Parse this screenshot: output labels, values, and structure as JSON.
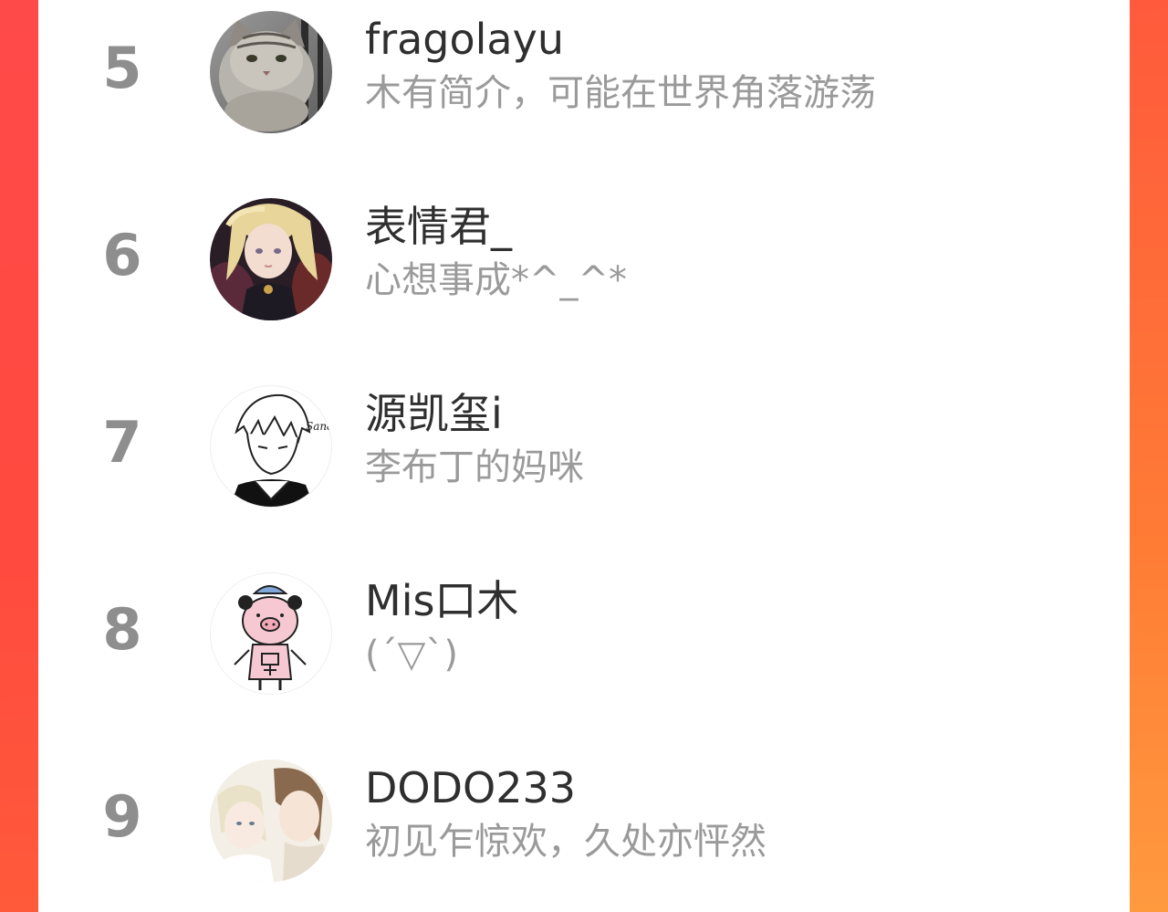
{
  "ranking": {
    "entries": [
      {
        "rank": "5",
        "name": "fragolayu",
        "bio": "木有简介，可能在世界角落游荡",
        "avatar": "cat-photo-avatar"
      },
      {
        "rank": "6",
        "name": "表情君_",
        "bio": "心想事成*^_^*",
        "avatar": "anime-girl-avatar"
      },
      {
        "rank": "7",
        "name": "源凯玺i",
        "bio": "李布丁的妈咪",
        "avatar": "sketch-boy-avatar"
      },
      {
        "rank": "8",
        "name": "Mis口木",
        "bio": "(´▽`)",
        "avatar": "pig-doodle-avatar"
      },
      {
        "rank": "9",
        "name": "DODO233",
        "bio": "初见乍惊欢，久处亦怦然",
        "avatar": "anime-couple-avatar"
      }
    ]
  },
  "colors": {
    "accent_left": "#ff4a44",
    "accent_right": "#ff8a38",
    "rank_text": "#8e8e8e",
    "name_text": "#2f2f2f",
    "bio_text": "#9a9a9a"
  }
}
